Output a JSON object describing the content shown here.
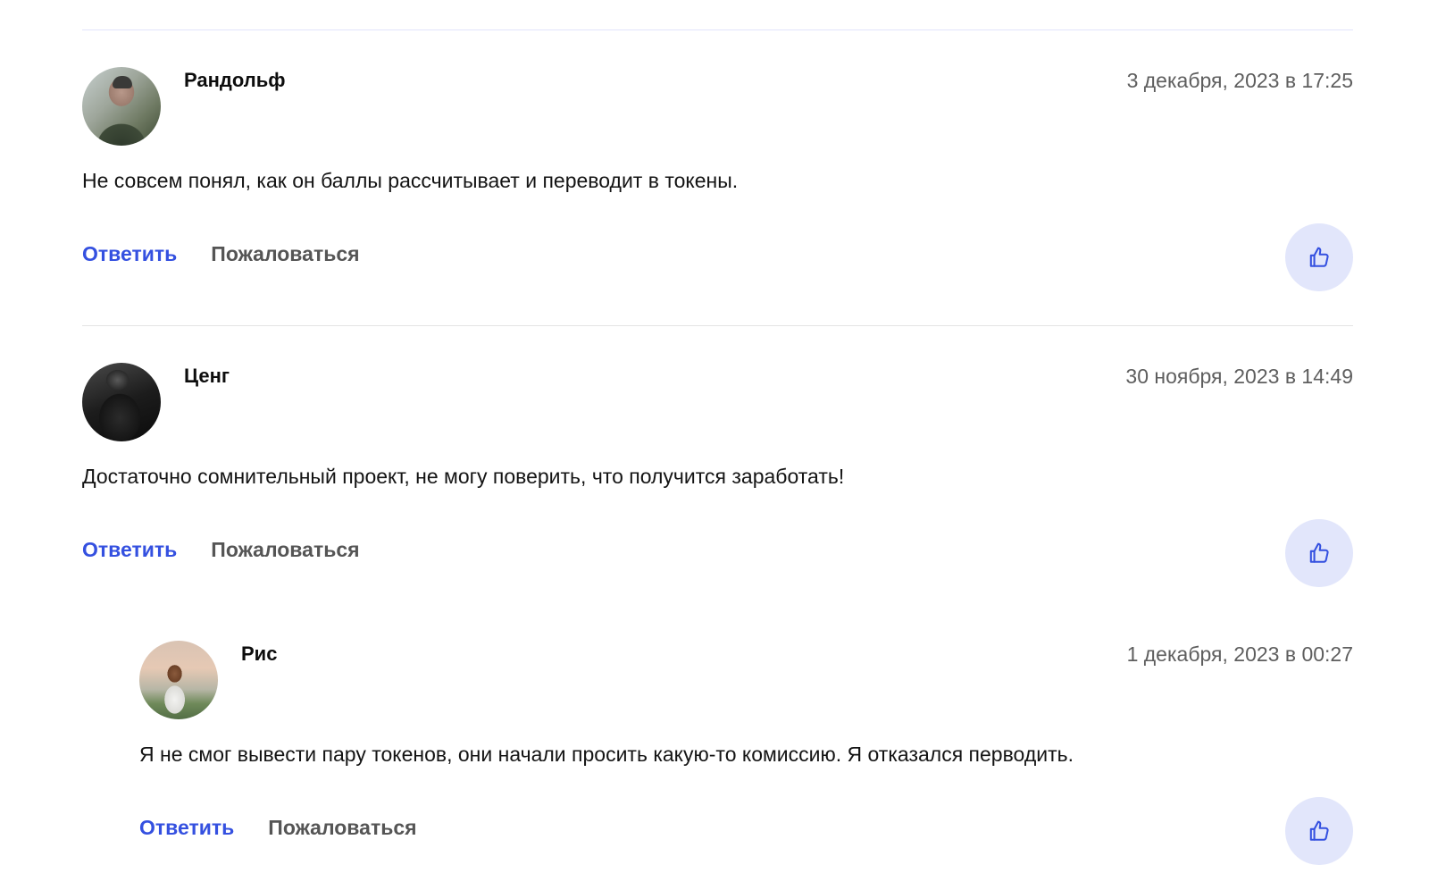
{
  "comments": [
    {
      "author": "Рандольф",
      "date": "3 декабря, 2023 в 17:25",
      "text": "Не совсем понял, как он баллы рассчитывает и переводит в токены.",
      "reply_label": "Ответить",
      "report_label": "Пожаловаться",
      "like_icon": "thumbs-up-icon"
    },
    {
      "author": "Ценг",
      "date": "30 ноября, 2023 в 14:49",
      "text": "Достаточно сомнительный проект, не могу поверить, что получится заработать!",
      "reply_label": "Ответить",
      "report_label": "Пожаловаться",
      "like_icon": "thumbs-up-icon"
    },
    {
      "author": "Рис",
      "date": "1 декабря, 2023 в 00:27",
      "text": "Я не смог вывести пару токенов, они начали просить какую-то комиссию. Я отказался перводить.",
      "reply_label": "Ответить",
      "report_label": "Пожаловаться",
      "like_icon": "thumbs-up-icon",
      "is_reply": true
    }
  ],
  "colors": {
    "accent": "#3450e0",
    "like_bg": "#e2e6fb",
    "muted_text": "#5e5e5e"
  }
}
